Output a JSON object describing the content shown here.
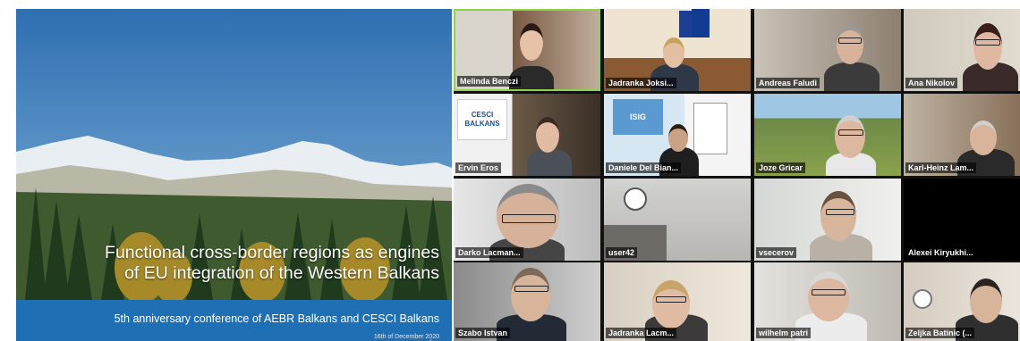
{
  "slide": {
    "title_line1": "Functional cross-border regions as engines",
    "title_line2": "of EU integration of the Western Balkans",
    "subtitle": "5th anniversary conference of AEBR Balkans and CESCI Balkans",
    "date": "16th of December 2020",
    "format": "online"
  },
  "participants": [
    {
      "name": "Melinda Benczi",
      "active": true
    },
    {
      "name": "Jadranka Joksi...",
      "active": false
    },
    {
      "name": "Andreas Faludi",
      "active": false
    },
    {
      "name": "Ana Nikolov",
      "active": false
    },
    {
      "name": "Ervin Eros",
      "active": false,
      "logo": "CESCI BALKANS"
    },
    {
      "name": "Daniele Del Bian...",
      "active": false,
      "logo": "ISIG"
    },
    {
      "name": "Joze Gricar",
      "active": false
    },
    {
      "name": "Karl-Heinz Lam...",
      "active": false
    },
    {
      "name": "Darko Lacman...",
      "active": false
    },
    {
      "name": "user42",
      "active": false
    },
    {
      "name": "vsecerov",
      "active": false
    },
    {
      "name": "Alexei Kiryukhi...",
      "active": false
    },
    {
      "name": "Szabo Istvan",
      "active": false
    },
    {
      "name": "Jadranka Lacm...",
      "active": false
    },
    {
      "name": "wilhelm patri",
      "active": false
    },
    {
      "name": "Zeljka Batinic (...",
      "active": false
    }
  ],
  "colors": {
    "active_border": "#8fd14f",
    "slide_band": "#1f6fb5"
  }
}
